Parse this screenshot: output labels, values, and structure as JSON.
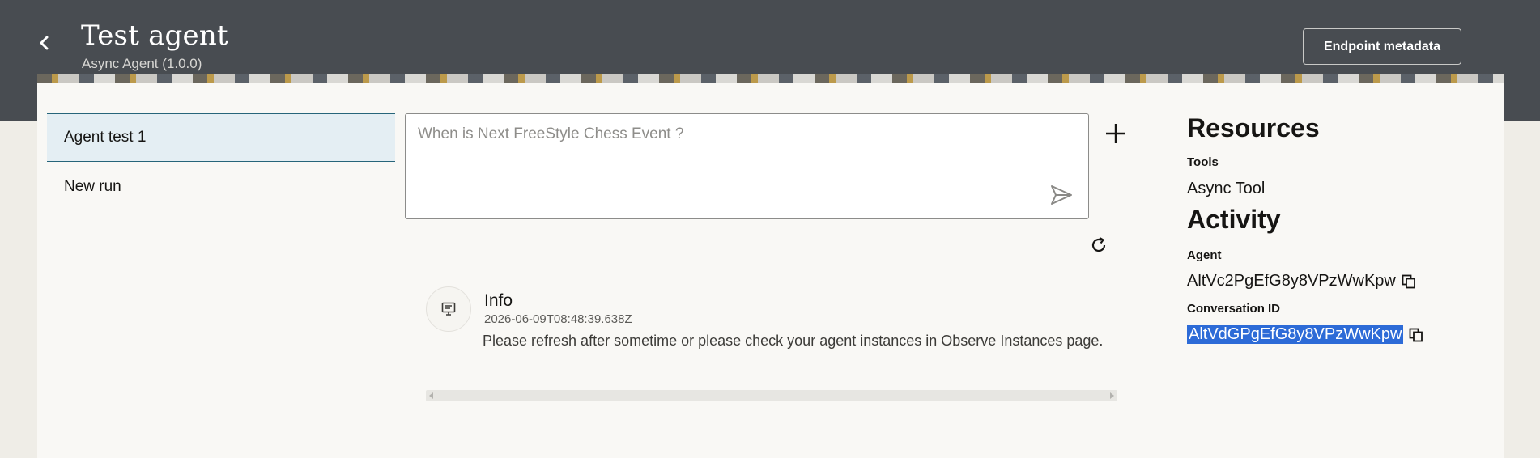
{
  "header": {
    "title": "Test agent",
    "subtitle": "Async Agent (1.0.0)",
    "endpoint_button": "Endpoint metadata"
  },
  "sidebar": {
    "items": [
      {
        "label": "Agent test 1",
        "active": true
      },
      {
        "label": "New run",
        "active": false
      }
    ]
  },
  "prompt": {
    "placeholder": "When is Next FreeStyle Chess Event ?",
    "value": ""
  },
  "messages": [
    {
      "title": "Info",
      "timestamp": "2026-06-09T08:48:39.638Z",
      "text": "Please refresh after sometime or please check your agent instances in Observe Instances page."
    }
  ],
  "resources": {
    "heading": "Resources",
    "tools_label": "Tools",
    "tools_value": "Async Tool"
  },
  "activity": {
    "heading": "Activity",
    "agent_label": "Agent",
    "agent_id": "AltVc2PgEfG8y8VPzWwKpw",
    "conversation_label": "Conversation ID",
    "conversation_id": "AltVdGPgEfG8y8VPzWwKpw"
  },
  "icons": {
    "back": "chevron-left-icon",
    "add": "plus-icon",
    "send": "send-icon",
    "refresh": "refresh-icon",
    "info": "info-board-icon",
    "copy": "copy-icon"
  },
  "colors": {
    "header_bg": "#484c51",
    "active_item_bg": "#e4eef3",
    "active_item_border": "#27657a",
    "selection": "#2d6bd7"
  }
}
